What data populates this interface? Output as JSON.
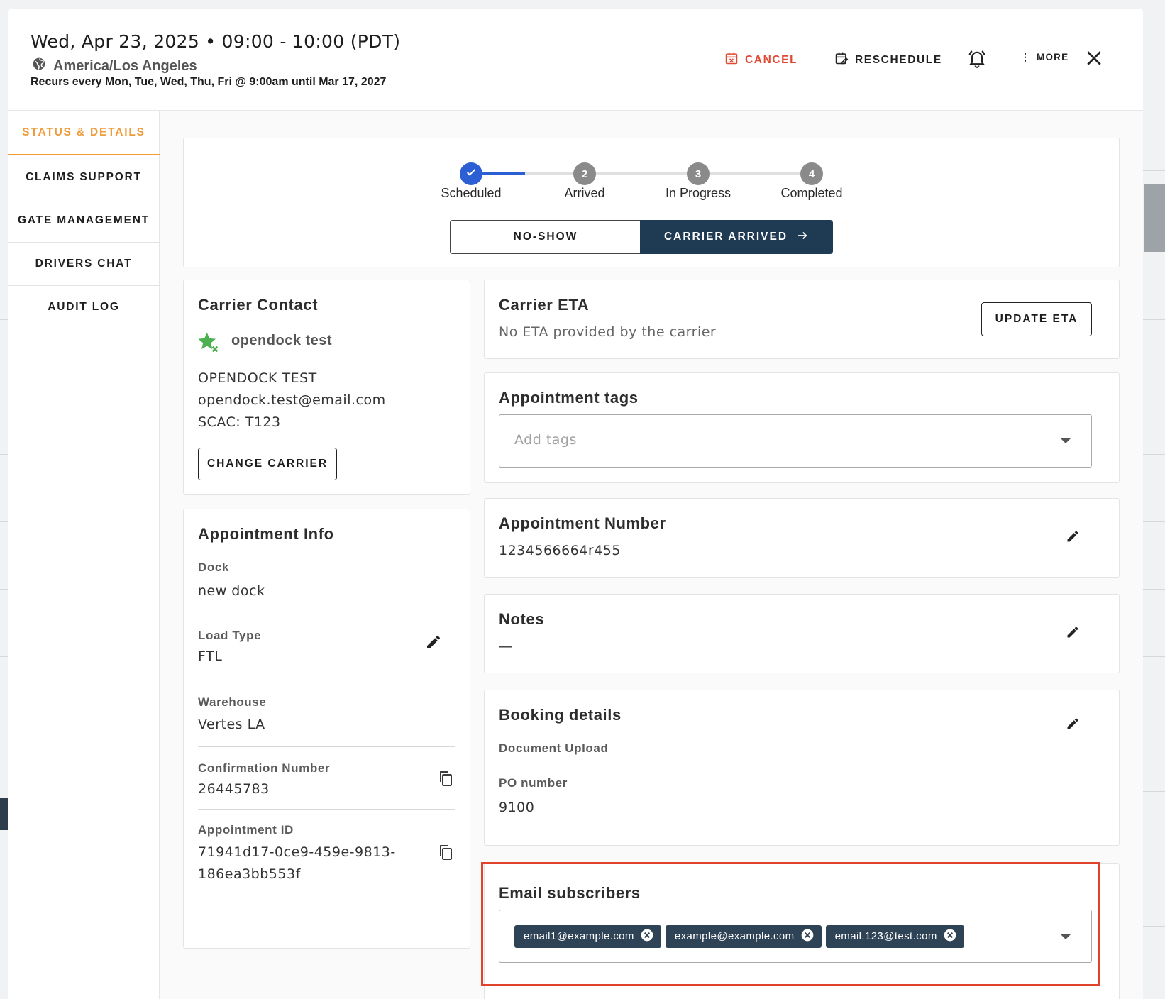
{
  "header": {
    "date": "Wed, Apr 23, 2025 • 09:00 - 10:00 (PDT)",
    "timezone": "America/Los Angeles",
    "recurrence": "Recurs every Mon, Tue, Wed, Thu, Fri @ 9:00am until Mar 17, 2027",
    "cancel_label": "CANCEL",
    "reschedule_label": "RESCHEDULE",
    "more_label": "MORE"
  },
  "nav": {
    "items": [
      {
        "label": "STATUS & DETAILS"
      },
      {
        "label": "CLAIMS SUPPORT"
      },
      {
        "label": "GATE MANAGEMENT"
      },
      {
        "label": "DRIVERS CHAT"
      },
      {
        "label": "AUDIT LOG"
      }
    ]
  },
  "status": {
    "steps": [
      {
        "number": "",
        "label": "Scheduled"
      },
      {
        "number": "2",
        "label": "Arrived"
      },
      {
        "number": "3",
        "label": "In Progress"
      },
      {
        "number": "4",
        "label": "Completed"
      }
    ],
    "no_show_label": "NO-SHOW",
    "carrier_arrived_label": "CARRIER ARRIVED"
  },
  "carrier_contact": {
    "title": "Carrier Contact",
    "name": "opendock test",
    "company": "OPENDOCK TEST",
    "email": "opendock.test@email.com",
    "scac": "SCAC: T123",
    "change_label": "CHANGE CARRIER"
  },
  "appointment_info": {
    "title": "Appointment Info",
    "dock_label": "Dock",
    "dock_value": "new dock",
    "load_type_label": "Load Type",
    "load_type_value": "FTL",
    "warehouse_label": "Warehouse",
    "warehouse_value": "Vertes LA",
    "confirmation_label": "Confirmation Number",
    "confirmation_value": "26445783",
    "appointment_id_label": "Appointment ID",
    "appointment_id_line1": "71941d17-0ce9-459e-9813-",
    "appointment_id_line2": "186ea3bb553f"
  },
  "carrier_eta": {
    "title": "Carrier ETA",
    "text": "No ETA provided by the carrier",
    "update_label": "UPDATE ETA"
  },
  "appointment_tags": {
    "title": "Appointment tags",
    "placeholder": "Add tags"
  },
  "appointment_number": {
    "title": "Appointment Number",
    "value": "1234566664r455"
  },
  "notes": {
    "title": "Notes",
    "value": "—"
  },
  "booking_details": {
    "title": "Booking details",
    "document_upload_label": "Document Upload",
    "po_label": "PO number",
    "po_value": "9100"
  },
  "email_subscribers": {
    "title": "Email subscribers",
    "emails": [
      "email1@example.com",
      "example@example.com",
      "email.123@test.com"
    ]
  },
  "colors": {
    "accent_orange": "#ef9b3a",
    "primary_dark": "#1f3a53",
    "step_blue": "#2d5fd4",
    "cancel_red": "#e04a35",
    "highlight_red": "#e0432a"
  }
}
